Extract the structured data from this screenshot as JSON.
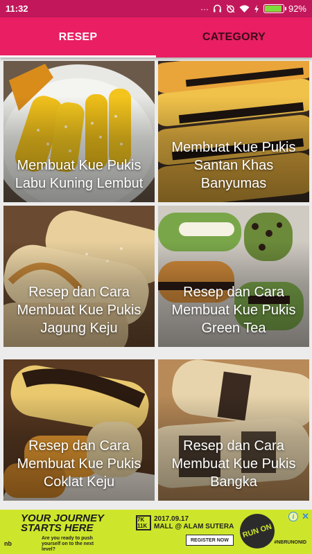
{
  "status_bar": {
    "time": "11:32",
    "battery_level": 0.92,
    "battery_text": "92%",
    "icons": [
      "more-icon",
      "headset-icon",
      "alarm-icon",
      "wifi-icon",
      "charging-icon",
      "battery-icon"
    ]
  },
  "tabs": [
    {
      "label": "RESEP",
      "active": true
    },
    {
      "label": "CATEGORY",
      "active": false
    }
  ],
  "recipes": [
    {
      "title": "Membuat Kue Pukis Labu Kuning Lembut"
    },
    {
      "title": "Membuat Kue Pukis Santan Khas Banyumas"
    },
    {
      "title": "Resep dan Cara Membuat Kue Pukis Jagung Keju"
    },
    {
      "title": "Resep dan Cara Membuat Kue Pukis Green Tea"
    },
    {
      "title": "Resep dan Cara Membuat Kue Pukis Coklat Keju"
    },
    {
      "title": "Resep dan Cara Membuat Kue Pukis Bangka"
    }
  ],
  "ad": {
    "headline_1": "YOUR JOURNEY",
    "headline_2": "STARTS HERE",
    "subtext": "Are you ready to push yourself on to the next level?",
    "distance": "7K 11K",
    "event_date": "2017.09.17",
    "event_venue": "MALL @ ALAM SUTERA",
    "register_label": "REGISTER NOW",
    "logo_text": "RUN ON",
    "hashtag": "#NBRUNONID",
    "brand": "nb"
  },
  "colors": {
    "status_bar": "#c2185b",
    "tab_bar": "#e91e63",
    "tab_active_text": "#ffffff",
    "tab_inactive_text": "#3b0a1a",
    "ad_background": "#cde62c"
  }
}
